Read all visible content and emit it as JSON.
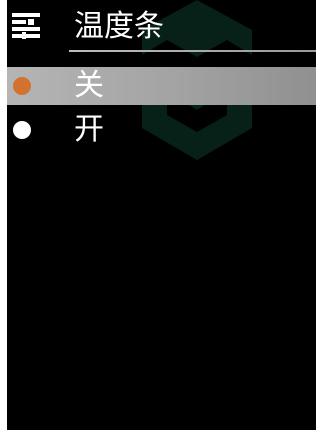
{
  "header": {
    "icon": "settings-list-icon",
    "title": "温度条"
  },
  "options": [
    {
      "label": "关",
      "selected": true,
      "indicator": "radio-dot-icon",
      "indicator_color": "#d2722e"
    },
    {
      "label": "开",
      "selected": false,
      "indicator": "radio-dot-icon",
      "indicator_color": "#ffffff"
    }
  ],
  "colors": {
    "background": "#000000",
    "selected_row": "#a8a8a8",
    "accent": "#d2722e",
    "text": "#ffffff"
  }
}
